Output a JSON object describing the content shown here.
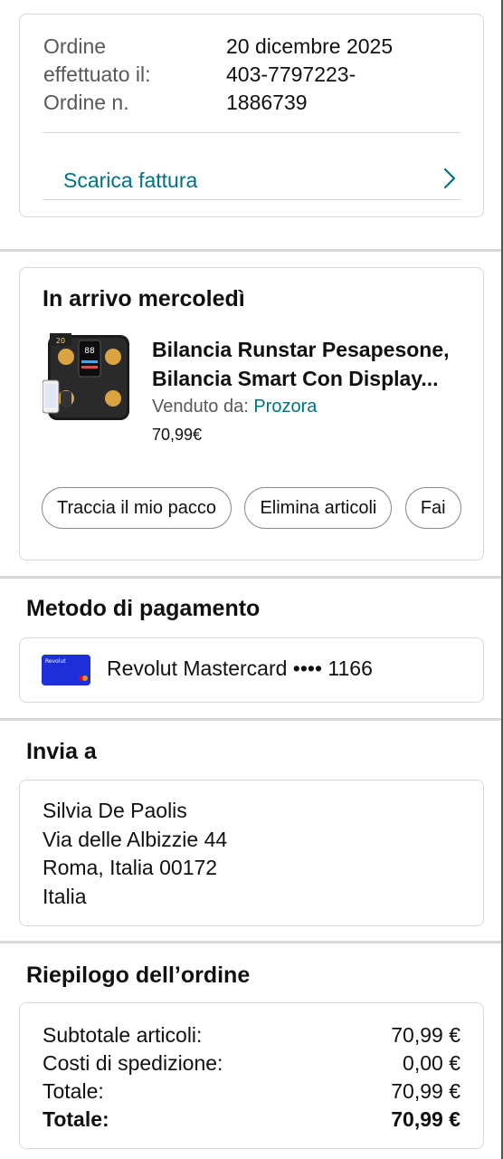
{
  "order_info": {
    "date_label": "Ordine effettuato il:",
    "date_value": "20 dicembre 2025",
    "number_label": "Ordine n.",
    "number_value_line1": "403-7797223-",
    "number_value_line2": "1886739",
    "label_line1": "Ordine",
    "label_line2": "effettuato il:",
    "label_line3": "Ordine n.",
    "invoice_link": "Scarica fattura"
  },
  "delivery": {
    "title": "In arrivo mercoledì",
    "product_name_line1": "Bilancia Runstar Pesapesone,",
    "product_name_line2": "Bilancia Smart Con Display...",
    "sold_by_label": "Venduto da:",
    "seller": "Prozora",
    "price": "70,99€",
    "actions": [
      "Traccia il mio pacco",
      "Elimina articoli",
      "Fai"
    ]
  },
  "payment": {
    "title": "Metodo di pagamento",
    "card_label": "Revolut Mastercard •••• 1166",
    "card_brand_text": "Revolut"
  },
  "shipping": {
    "title": "Invia a",
    "address_lines": [
      "Silvia De Paolis",
      "Via delle Albizzie 44",
      "Roma, Italia 00172",
      "Italia"
    ]
  },
  "summary": {
    "title": "Riepilogo dell’ordine",
    "rows": [
      {
        "label": "Subtotale articoli:",
        "value": "70,99 €"
      },
      {
        "label": "Costi di spedizione:",
        "value": "0,00 €"
      },
      {
        "label": "Totale:",
        "value": "70,99 €"
      },
      {
        "label": "Totale:",
        "value": "70,99 €"
      }
    ]
  },
  "colors": {
    "link": "#007185",
    "text": "#0f1111",
    "secondary_text": "#565959",
    "border": "#d5d9d9",
    "card_blue": "#1d2fd9"
  }
}
